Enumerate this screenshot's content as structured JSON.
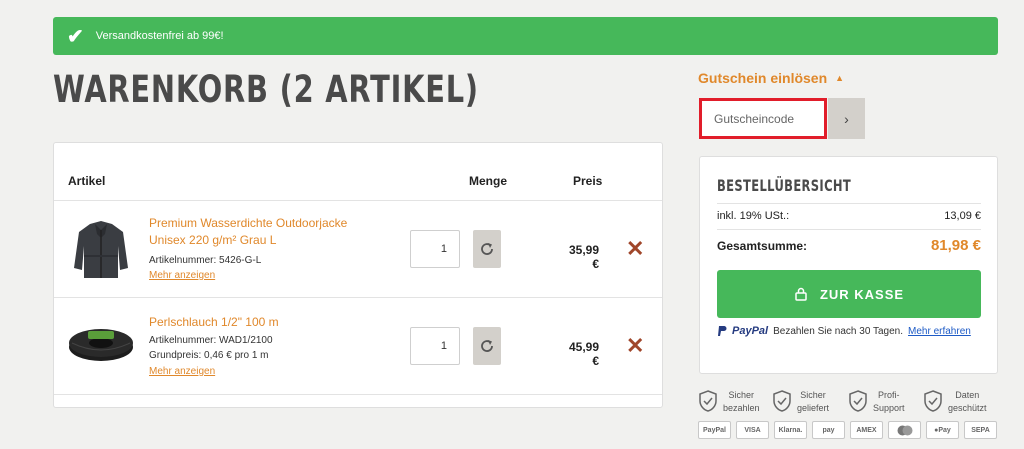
{
  "banner": {
    "text": "Versandkostenfrei ab 99€!"
  },
  "page_title": "WARENKORB (2 ARTIKEL)",
  "coupon": {
    "toggle_label": "Gutschein einlösen",
    "placeholder": "Gutscheincode",
    "submit_label": "›"
  },
  "cart": {
    "headers": {
      "article": "Artikel",
      "quantity": "Menge",
      "price": "Preis"
    },
    "items": [
      {
        "name": "Premium Wasserdichte Outdoorjacke Unisex 220 g/m² Grau L",
        "meta": [
          "Artikelnummer: 5426-G-L"
        ],
        "more_label": "Mehr anzeigen",
        "quantity": "1",
        "price": "35,99 €",
        "image": "jacket-image"
      },
      {
        "name": "Perlschlauch 1/2\" 100 m",
        "meta": [
          "Artikelnummer: WAD1/2100",
          "Grundpreis: 0,46 € pro 1 m"
        ],
        "more_label": "Mehr anzeigen",
        "quantity": "1",
        "price": "45,99 €",
        "image": "hose-image"
      }
    ]
  },
  "summary": {
    "title": "BESTELLÜBERSICHT",
    "vat_label": "inkl. 19% USt.:",
    "vat_value": "13,09 €",
    "total_label": "Gesamtsumme:",
    "total_value": "81,98 €",
    "checkout_label": "ZUR KASSE",
    "paypal_logo": "PayPal",
    "paypal_text": "Bezahlen Sie nach 30 Tagen.",
    "paypal_link": "Mehr erfahren"
  },
  "trust_badges": [
    {
      "line1": "Sicher",
      "line2": "bezahlen"
    },
    {
      "line1": "Sicher",
      "line2": "geliefert"
    },
    {
      "line1": "Profi-",
      "line2": "Support"
    },
    {
      "line1": "Daten",
      "line2": "geschützt"
    }
  ],
  "payment_methods": [
    "PayPal",
    "VISA",
    "Klarna.",
    "pay",
    "AMEX",
    "",
    "Pay",
    "SEPA"
  ],
  "colors": {
    "accent_green": "#46b85a",
    "accent_orange": "#e0882b",
    "remove_red": "#a0462a",
    "highlight_red": "#e11d2a"
  }
}
